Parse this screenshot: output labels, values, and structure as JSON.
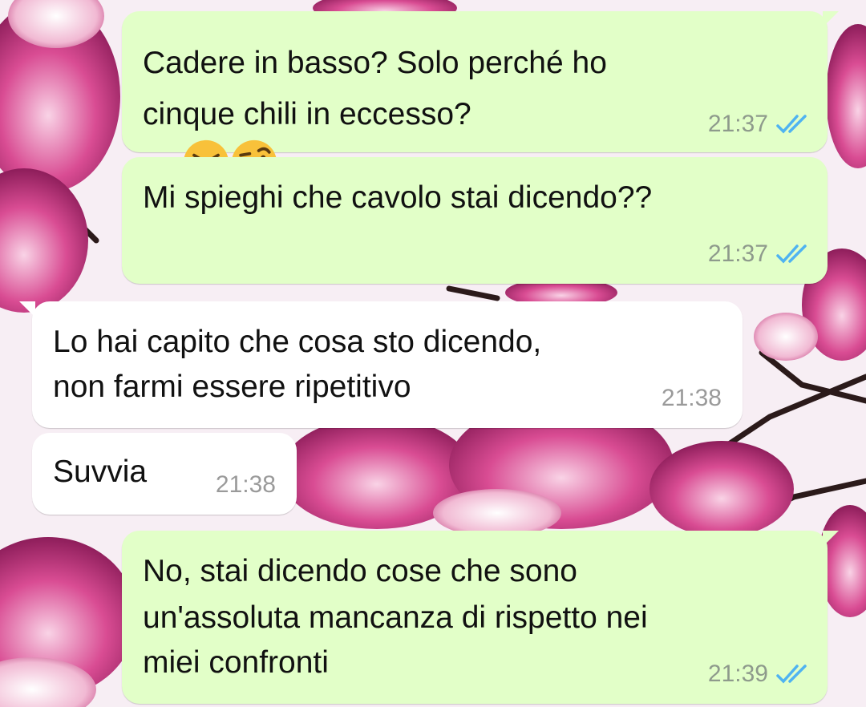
{
  "colors": {
    "outgoing_bubble": "#e2ffc8",
    "incoming_bubble": "#ffffff",
    "read_ticks": "#4fb3f1",
    "timestamp": "#8e9a8c"
  },
  "messages": [
    {
      "direction": "outgoing",
      "lines": [
        "Cadere in basso? Solo perché ho",
        "cinque chili in eccesso?"
      ],
      "emojis": [
        "confounded-face-icon",
        "face-with-raised-eyebrow-icon"
      ],
      "time": "21:37",
      "status": "read"
    },
    {
      "direction": "outgoing",
      "lines": [
        "Mi spieghi che cavolo stai dicendo??"
      ],
      "time": "21:37",
      "status": "read"
    },
    {
      "direction": "incoming",
      "lines": [
        "Lo hai capito che cosa sto dicendo,",
        "non farmi essere ripetitivo"
      ],
      "time": "21:38"
    },
    {
      "direction": "incoming",
      "lines": [
        "Suvvia"
      ],
      "time": "21:38"
    },
    {
      "direction": "outgoing",
      "lines": [
        "No, stai dicendo cose che sono",
        "un'assoluta mancanza di rispetto nei",
        "miei confronti"
      ],
      "time": "21:39",
      "status": "read"
    }
  ]
}
